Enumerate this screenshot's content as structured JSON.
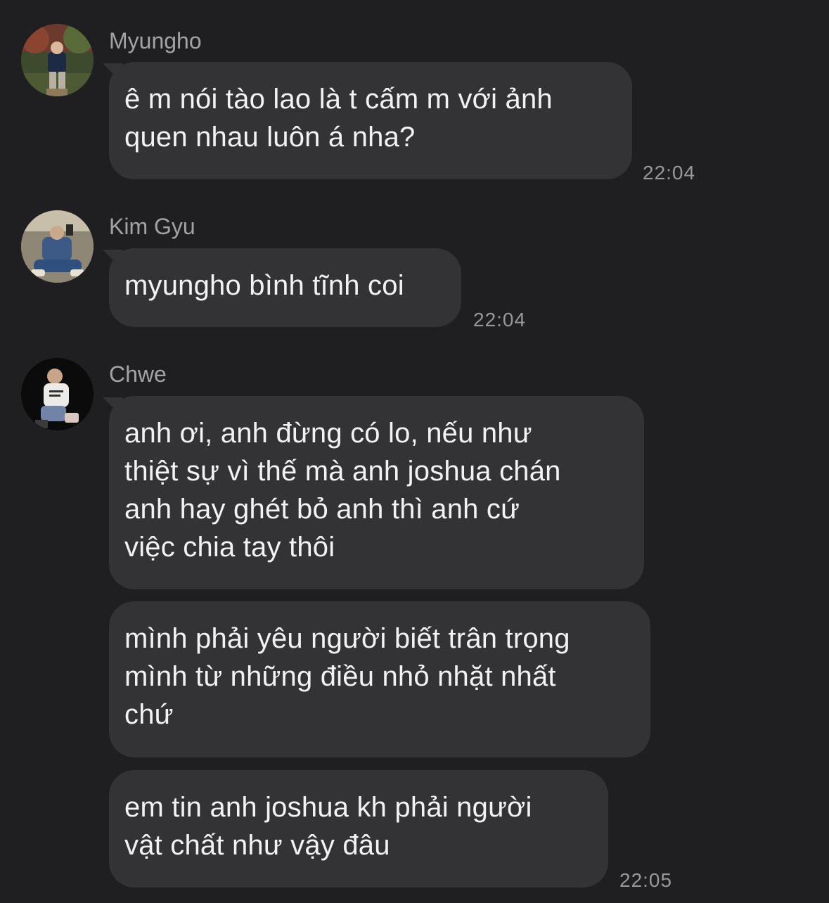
{
  "messages": [
    {
      "sender": "Myungho",
      "avatar_icon": "myungho-avatar-photo",
      "bubbles": [
        {
          "text": "ê m nói tào lao là t cấm m với ảnh\nquen nhau luôn á nha?",
          "time": "22:04"
        }
      ]
    },
    {
      "sender": "Kim Gyu",
      "avatar_icon": "kim-gyu-avatar-photo",
      "bubbles": [
        {
          "text": "myungho bình tĩnh coi",
          "time": "22:04"
        }
      ]
    },
    {
      "sender": "Chwe",
      "avatar_icon": "chwe-avatar-photo",
      "bubbles": [
        {
          "text": "anh ơi, anh đừng có lo, nếu như\nthiệt sự vì thế mà anh joshua chán\nanh hay ghét bỏ anh thì anh cứ\nviệc chia tay thôi",
          "time": ""
        },
        {
          "text": "mình phải yêu người biết trân trọng\nmình từ những điều nhỏ nhặt nhất\nchứ",
          "time": ""
        },
        {
          "text": "em tin anh joshua kh phải người\nvật chất như vậy đâu",
          "time": "22:05"
        }
      ]
    }
  ],
  "colors": {
    "background": "#1f1f21",
    "bubble": "#333335",
    "message_text": "#f2f2f4",
    "sender_text": "#a3a3a6",
    "timestamp_text": "#98989c"
  }
}
